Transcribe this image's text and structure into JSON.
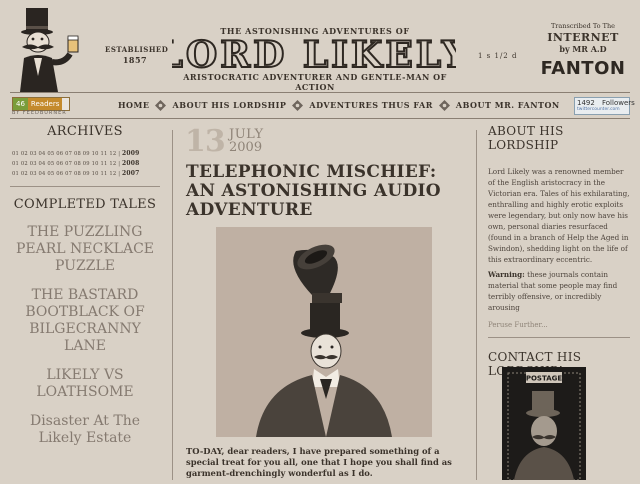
{
  "header": {
    "established_label": "ESTABLISHED",
    "established_year": "1857",
    "pre_title": "THE ASTONISHING ADVENTURES OF",
    "logo_text": "LORD LIKELY",
    "subtitle": "ARISTOCRATIC ADVENTURER AND GENTLE-MAN OF ACTION",
    "price": "1 s 1/2 d",
    "transcribed": "Transcribed To The",
    "internet": "INTERNET",
    "by": "by MR A.D",
    "author": "FANTON"
  },
  "feed": {
    "count": "46",
    "label": "Readers",
    "by": "BY FEEDBURNER"
  },
  "nav": {
    "items": [
      "HOME",
      "ABOUT HIS LORDSHIP",
      "ADVENTURES THUS FAR",
      "ABOUT MR. FANTON"
    ]
  },
  "followers": {
    "count": "1492",
    "label": "Followers",
    "source": "twittercounter.com"
  },
  "archives": {
    "title": "ARCHIVES",
    "rows": [
      {
        "months": "01 02 03 04 05 06 07 08 09 10 11 12",
        "year": "2009"
      },
      {
        "months": "01 02 03 04 05 06 07 08 09 10 11 12",
        "year": "2008"
      },
      {
        "months": "01 02 03 04 05 06 07 08 09 10 11 12",
        "year": "2007"
      }
    ]
  },
  "tales": {
    "title": "COMPLETED TALES",
    "items": [
      "THE PUZZLING PEARL NECKLACE PUZZLE",
      "THE BASTARD BOOTBLACK OF BILGECRANNY LANE",
      "LIKELY VS LOATHSOME",
      "Disaster At The Likely Estate"
    ]
  },
  "post": {
    "day": "13",
    "month": "JULY",
    "year": "2009",
    "title": "TELEPHONIC MISCHIEF: AN ASTONISHING AUDIO ADVENTURE",
    "body": "TO-DAY, dear readers, I have prepared something of a special treat for you all, one that I hope you shall find as garment-drenchingly wonderful as I do."
  },
  "about": {
    "title": "ABOUT HIS LORDSHIP",
    "text": "Lord Likely was a renowned member of the English aristocracy in the Victorian era. Tales of his exhilarating, enthralling and highly erotic exploits were legendary, but only now have his own, personal diaries resurfaced (found in a branch of Help the Aged in Swindon), shedding light on the life of this extraordinary eccentric.",
    "warning_label": "Warning:",
    "warning_text": "these journals contain material that some people may find terribly offensive, or incredibly arousing",
    "peruse": "Peruse Further..."
  },
  "contact": {
    "title": "CONTACT HIS LORDSHIP!",
    "stamp_text": "POSTAGE"
  },
  "colors": {
    "background": "#d9d1c6",
    "ink": "#3b332b",
    "muted": "#857a70",
    "rule": "#9c9186"
  }
}
